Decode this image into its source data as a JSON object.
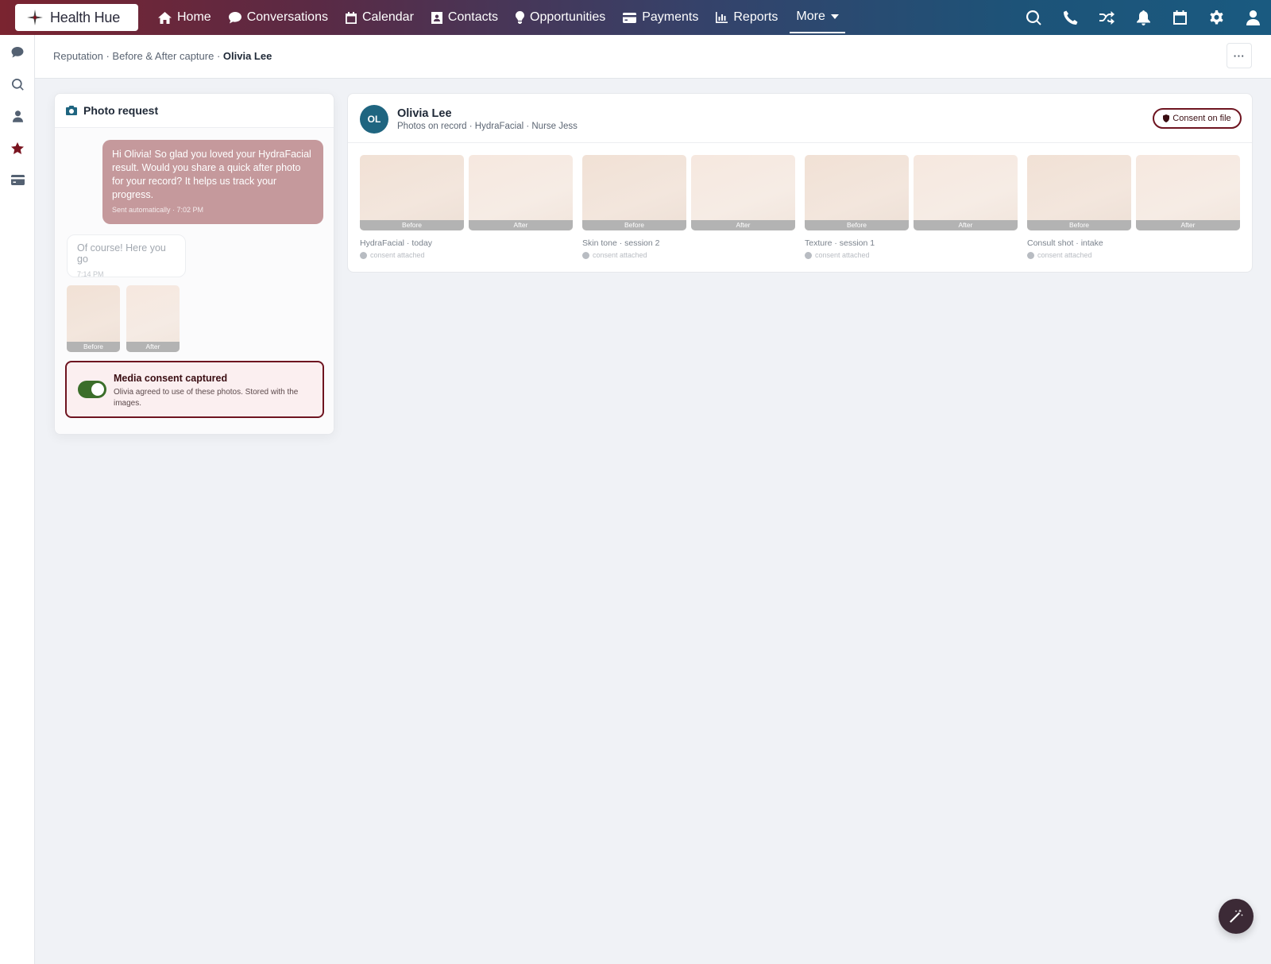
{
  "app": {
    "logo_text": "Health Hue"
  },
  "nav": {
    "items": [
      {
        "label": "Home",
        "icon": "home-icon"
      },
      {
        "label": "Conversations",
        "icon": "chat-icon"
      },
      {
        "label": "Calendar",
        "icon": "calendar-icon"
      },
      {
        "label": "Contacts",
        "icon": "contact-card-icon"
      },
      {
        "label": "Opportunities",
        "icon": "lightbulb-icon"
      },
      {
        "label": "Payments",
        "icon": "credit-card-icon"
      },
      {
        "label": "Reports",
        "icon": "bar-chart-icon"
      }
    ],
    "more_label": "More",
    "right_icons": [
      "search-icon",
      "phone-icon",
      "shuffle-icon",
      "bell-icon",
      "calendar-icon",
      "gear-icon",
      "user-icon"
    ]
  },
  "rail": {
    "icons": [
      "chat-icon",
      "search-icon",
      "user-icon",
      "star-icon",
      "credit-card-icon"
    ],
    "active": "star-icon"
  },
  "breadcrumb": {
    "prefix": "Reputation · Before & After capture · ",
    "current": "Olivia Lee"
  },
  "photo_request": {
    "title": "Photo request",
    "outgoing": {
      "message": "Hi Olivia! So glad you loved your HydraFacial result. Would you share a quick after photo for your record? It helps us track your progress.",
      "meta": "Sent automatically · 7:02 PM"
    },
    "incoming": {
      "message": "Of course! Here you go",
      "meta": "7:14 PM"
    },
    "photos": [
      "Before",
      "After"
    ],
    "consent": {
      "enabled": true,
      "title": "Media consent captured",
      "description": "Olivia agreed to use of these photos. Stored with the images."
    }
  },
  "patient": {
    "initials": "OL",
    "name": "Olivia Lee",
    "subtitle": "Photos on record · HydraFacial · Nurse Jess",
    "consent_pill": "Consent on file",
    "pairs": [
      {
        "caption": "HydraFacial · today",
        "before": "Before",
        "after": "After",
        "status": "consent attached"
      },
      {
        "caption": "Skin tone · session 2",
        "before": "Before",
        "after": "After",
        "status": "consent attached"
      },
      {
        "caption": "Texture · session 1",
        "before": "Before",
        "after": "After",
        "status": "consent attached"
      },
      {
        "caption": "Consult shot · intake",
        "before": "Before",
        "after": "After",
        "status": "consent attached"
      }
    ]
  },
  "colors": {
    "brand_maroon": "#6e1420",
    "accent_teal": "#1f6580",
    "toggle_on": "#3b6e2a",
    "bubble_out": "#c5999c"
  }
}
